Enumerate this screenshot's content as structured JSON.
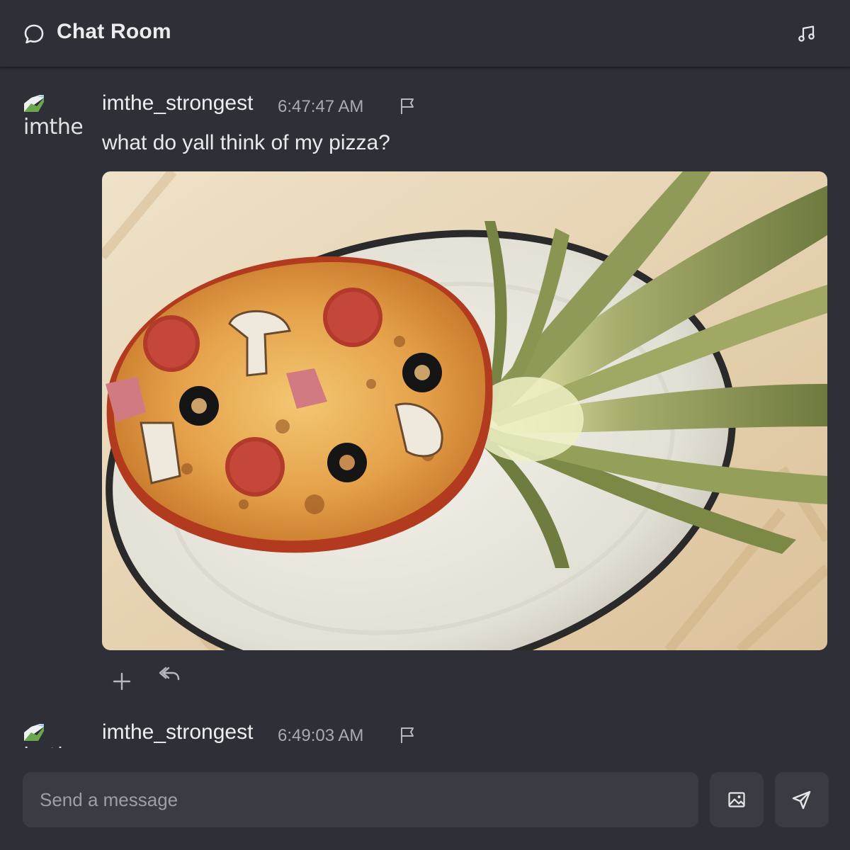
{
  "header": {
    "title": "Chat Room",
    "chat_icon": "chat-bubble-icon",
    "music_icon": "music-note-icon"
  },
  "messages": [
    {
      "avatar_alt": "imthe",
      "username": "imthe_strongest",
      "timestamp": "6:47:47 AM",
      "text": "what do yall think of my pizza?",
      "image": {
        "description_icon": "pizza-photo",
        "toppings": [
          "pepperoni",
          "mushroom",
          "black olive",
          "ham"
        ]
      },
      "actions": [
        "plus-icon",
        "reply-icon"
      ]
    },
    {
      "avatar_alt": "imthe",
      "username": "imthe_strongest",
      "timestamp": "6:49:03 AM"
    }
  ],
  "composer": {
    "placeholder": "Send a message",
    "image_button_icon": "image-icon",
    "send_button_icon": "send-icon"
  },
  "colors": {
    "background": "#2f3037",
    "input_background": "#3a3b43",
    "text": "#e6e6e9",
    "muted_text": "#a9aab2"
  }
}
